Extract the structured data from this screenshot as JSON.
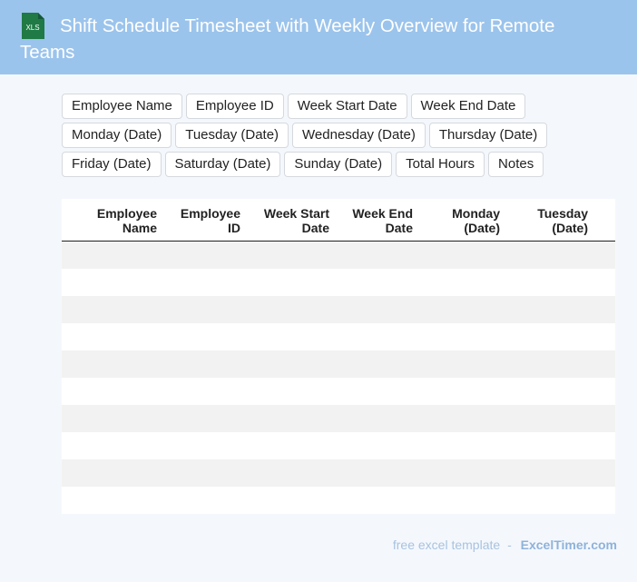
{
  "header": {
    "icon_label": "XLS",
    "title": "Shift Schedule Timesheet with Weekly Overview for Remote Teams"
  },
  "fields": [
    "Employee Name",
    "Employee ID",
    "Week Start Date",
    "Week End Date",
    "Monday (Date)",
    "Tuesday (Date)",
    "Wednesday (Date)",
    "Thursday (Date)",
    "Friday (Date)",
    "Saturday (Date)",
    "Sunday (Date)",
    "Total Hours",
    "Notes"
  ],
  "table": {
    "columns": [
      [
        "Employee",
        "Name"
      ],
      [
        "Employee",
        "ID"
      ],
      [
        "Week Start",
        "Date"
      ],
      [
        "Week End",
        "Date"
      ],
      [
        "Monday",
        "(Date)"
      ],
      [
        "Tuesday",
        "(Date)"
      ]
    ],
    "row_count": 10
  },
  "footer": {
    "text": "free excel template",
    "separator": "-",
    "brand": "ExcelTimer.com"
  },
  "colors": {
    "header_bg": "#9bc4ec",
    "page_bg": "#f4f8fd",
    "row_alt": "#f2f2f2",
    "icon_green": "#1f7a45"
  }
}
